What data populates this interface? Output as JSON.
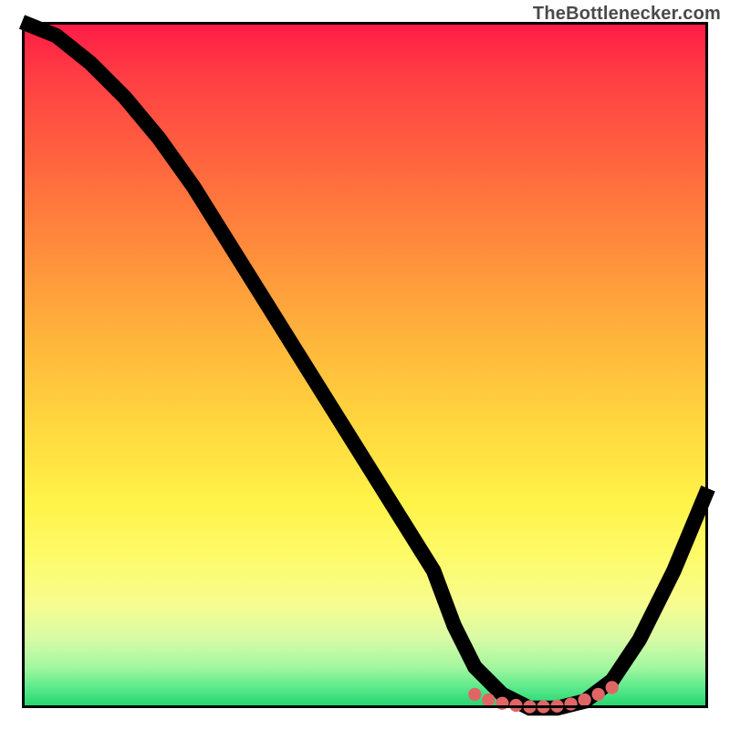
{
  "attribution": "TheBottlenecker.com",
  "colors": {
    "marker": "#e06666",
    "line": "#000000",
    "gradient_top": "#ff1a46",
    "gradient_bottom": "#1ed46f"
  },
  "chart_data": {
    "type": "line",
    "title": "",
    "xlabel": "",
    "ylabel": "",
    "xlim": [
      0,
      100
    ],
    "ylim": [
      0,
      100
    ],
    "series": [
      {
        "name": "bottleneck-curve",
        "x": [
          0,
          5,
          10,
          15,
          20,
          25,
          30,
          35,
          40,
          45,
          50,
          55,
          60,
          63,
          66,
          70,
          74,
          78,
          82,
          86,
          90,
          95,
          100
        ],
        "y": [
          100,
          98,
          94,
          89,
          83,
          76,
          68,
          60,
          52,
          44,
          36,
          28,
          20,
          12,
          6,
          2,
          0,
          0,
          1,
          4,
          10,
          20,
          32
        ]
      }
    ],
    "markers": {
      "name": "optimal-zone-markers",
      "x": [
        66,
        68,
        70,
        72,
        74,
        76,
        78,
        80,
        82,
        84,
        86
      ],
      "y": [
        2,
        1.2,
        0.7,
        0.4,
        0.2,
        0.2,
        0.3,
        0.6,
        1.2,
        2.0,
        3.0
      ]
    }
  }
}
